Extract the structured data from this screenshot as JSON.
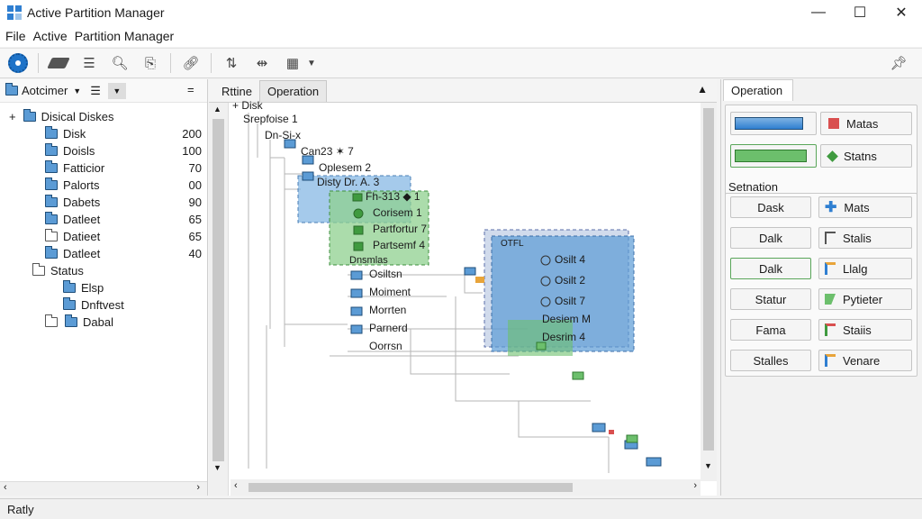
{
  "window": {
    "title": "Active Partition Manager",
    "controls": {
      "minimize": "—",
      "maximize": "☐",
      "close": "✕"
    }
  },
  "menu": [
    "File",
    "Active",
    "Partition Manager"
  ],
  "left_panel": {
    "header_label": "Aotcimer",
    "tree": [
      {
        "label": "Disical Diskes",
        "value": ""
      },
      {
        "label": "Disk",
        "value": "200"
      },
      {
        "label": "Doisls",
        "value": "100"
      },
      {
        "label": "Fatticior",
        "value": "70"
      },
      {
        "label": "Palorts",
        "value": "00"
      },
      {
        "label": "Dabets",
        "value": "90"
      },
      {
        "label": "Datleet",
        "value": "65"
      },
      {
        "label": "Datieet",
        "value": "65"
      },
      {
        "label": "Datleet",
        "value": "40"
      },
      {
        "label": "Status",
        "value": ""
      },
      {
        "label": "Elsp",
        "value": ""
      },
      {
        "label": "Dnftvest",
        "value": ""
      },
      {
        "label": "Dabal",
        "value": ""
      }
    ]
  },
  "middle_panel": {
    "tabs": [
      "Rttine",
      "Operation"
    ],
    "diagram_labels": {
      "disk": "+ Disk",
      "sub1": "Srepfoise 1",
      "sub2": "Dn-Si-x",
      "sub3": "Can23 ✶ 7",
      "sub4": "Oplesem 2",
      "sub5": "Disty Dr. A. 3",
      "g1": "Fh-313 ◆ 1",
      "g2": "Corisem 1",
      "g3": "Partfortur 7",
      "g4": "Partsemf 4",
      "lonely": "Dnsmlas",
      "l1": "Osiltsn",
      "l2": "Moiment",
      "l3": "Morrten",
      "l4": "Parnerd",
      "l5": "Oorrsn",
      "bb_title": "OTFL",
      "b1": "Osilt 4",
      "b2": "Osilt 2",
      "b3": "Osilt 7",
      "b4": "Desiem M",
      "b5": "Desrim 4"
    }
  },
  "right_panel": {
    "tab": "Operation",
    "top_labels": [
      "Matas",
      "Statns"
    ],
    "section_title": "Setnation",
    "left_buttons": [
      "Dask",
      "Dalk",
      "Dalk",
      "Statur",
      "Fama",
      "Stalles"
    ],
    "right_buttons": [
      "Mats",
      "Stalis",
      "Llalg",
      "Pytieter",
      "Staiis",
      "Venare"
    ]
  },
  "status": {
    "text": "Ratly"
  },
  "colors": {
    "accent_blue": "#5b9bd5",
    "green": "#6cbf6c",
    "box_blue": "#7fb3e3",
    "box_green": "#8fd08f"
  }
}
